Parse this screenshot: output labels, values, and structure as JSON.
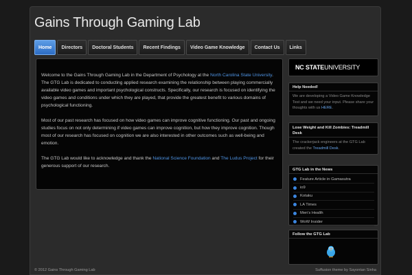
{
  "site": {
    "title": "Gains Through Gaming Lab"
  },
  "nav": {
    "items": [
      {
        "label": "Home",
        "active": true
      },
      {
        "label": "Directors"
      },
      {
        "label": "Doctoral Students"
      },
      {
        "label": "Recent Findings"
      },
      {
        "label": "Video Game Knowledge"
      },
      {
        "label": "Contact Us"
      },
      {
        "label": "Links"
      }
    ]
  },
  "content": {
    "p1": {
      "before": "Welcome to the Gains Through Gaming Lab in the Department of Psychology at the ",
      "link": "North Carolina State University",
      "after": ".  The GTG Lab is dedicated to conducting applied research examining the relationship between playing commercially available video games and important psychological constructs.  Specifically, our research is focused on identifying the video games and conditions under which they are played, that provide the greatest benefit to various domains of psychological functioning."
    },
    "p2": "Most of our past research has focused on how video games can improve cognitive functioning. Our past and ongoing studies focus on not only determining if video games can improve cognition, but how they improve cognition.  Though most of our research has focused on cognition we are also interested in other outcomes such as well-being and emotion.",
    "p3": {
      "before": "The GTG Lab would like to acknowledge and thank the ",
      "link1": "National Science Foundation",
      "middle": " and ",
      "link2": "The Ludus Project",
      "after": " for their generous support of our research."
    }
  },
  "sidebar": {
    "logo": {
      "bold": "NC STATE",
      "light": " UNIVERSITY"
    },
    "help": {
      "title": "Help Needed!",
      "body": "We are developing a Video Game Knowledge Test and we need your input. Please share your thoughts with us ",
      "link": "HERE",
      "end": "."
    },
    "zombies": {
      "title": "Lose Weight and Kill Zombies: Treadmill Desk",
      "body": "The crackerjack engineers at the GTG Lab created the ",
      "link": "Treadmill Desk",
      "end": "."
    },
    "news": {
      "title": "GTG Lab in the News",
      "items": [
        "Feature Article in Gamasutra",
        "io9",
        "Kotaku",
        "LA Times",
        "Men's Health",
        "WoW Insider"
      ],
      "bullet_color": "#3b86e0"
    },
    "follow": {
      "title": "Follow the GTG Lab",
      "icon": "twitter-bird-icon"
    }
  },
  "footer": {
    "left": "© 2012 Gains Through Gaming Lab",
    "right": "Suffusion theme by Sayontan Sinha"
  },
  "colors": {
    "accent": "#2c6cc4",
    "link": "#4f95e6",
    "background": "#1a1a1a",
    "panel": "#050505"
  }
}
